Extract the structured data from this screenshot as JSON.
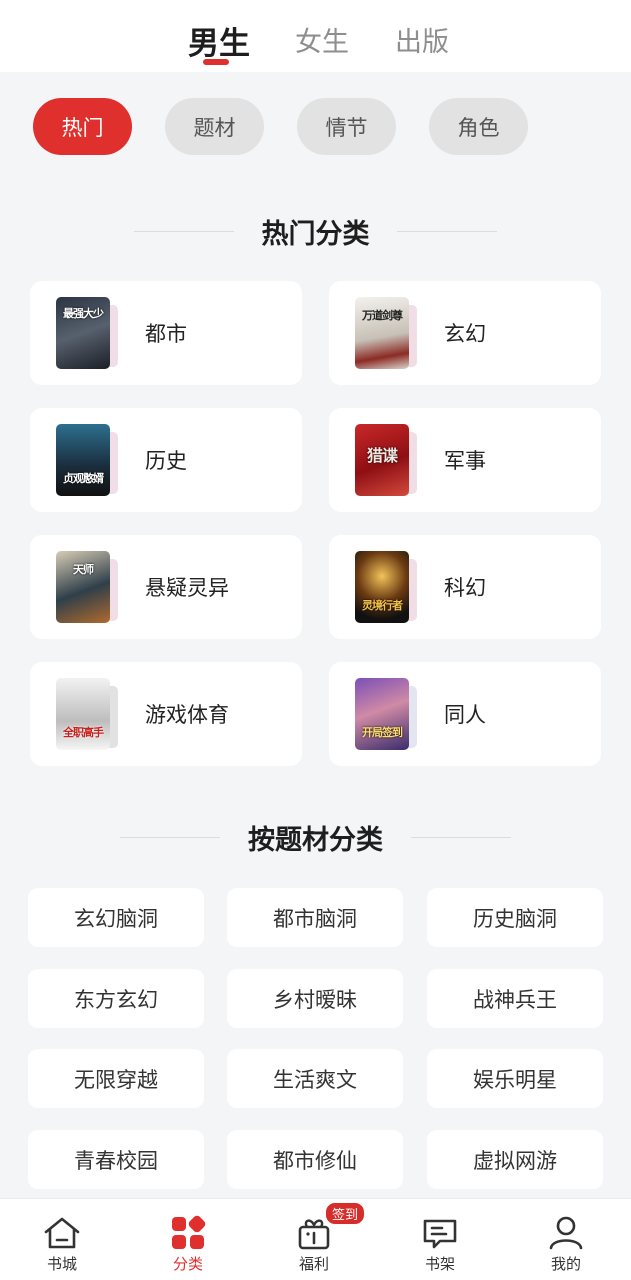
{
  "top_tabs": [
    "男生",
    "女生",
    "出版"
  ],
  "chips": [
    "热门",
    "题材",
    "情节",
    "角色"
  ],
  "hot_section": {
    "title": "热门分类",
    "categories": [
      {
        "name": "都市",
        "cover_text": "最强大少"
      },
      {
        "name": "玄幻",
        "cover_text": "万道剑尊"
      },
      {
        "name": "历史",
        "cover_text": "贞观憨婿"
      },
      {
        "name": "军事",
        "cover_text": "猎谍"
      },
      {
        "name": "悬疑灵异",
        "cover_text": "天师"
      },
      {
        "name": "科幻",
        "cover_text": "灵境行者"
      },
      {
        "name": "游戏体育",
        "cover_text": "全职高手"
      },
      {
        "name": "同人",
        "cover_text": "开局签到"
      }
    ]
  },
  "topic_section": {
    "title": "按题材分类",
    "topics": [
      "玄幻脑洞",
      "都市脑洞",
      "历史脑洞",
      "东方玄幻",
      "乡村暧昧",
      "战神兵王",
      "无限穿越",
      "生活爽文",
      "娱乐明星",
      "青春校园",
      "都市修仙",
      "虚拟网游"
    ]
  },
  "bottom_nav": {
    "items": [
      {
        "label": "书城",
        "icon": "home-icon"
      },
      {
        "label": "分类",
        "icon": "category-icon"
      },
      {
        "label": "福利",
        "icon": "gift-icon"
      },
      {
        "label": "书架",
        "icon": "bookshelf-icon"
      },
      {
        "label": "我的",
        "icon": "profile-icon"
      }
    ],
    "badge": "签到"
  },
  "colors": {
    "accent": "#e0302d",
    "background": "#f4f5f7"
  }
}
